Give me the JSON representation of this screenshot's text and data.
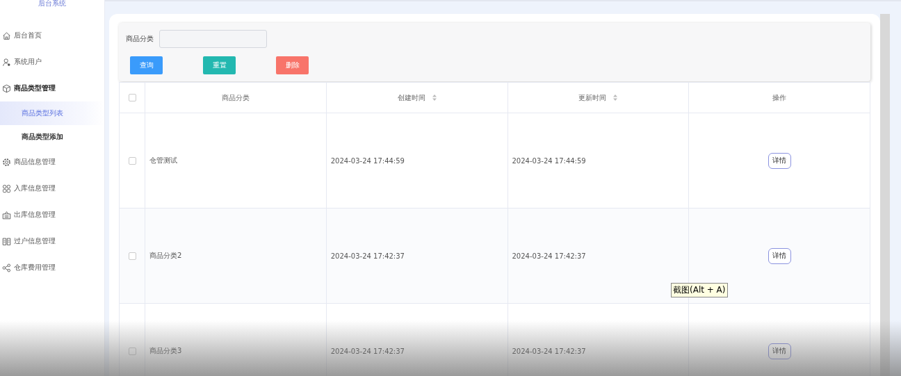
{
  "sidebar": {
    "title": "后台系统",
    "items": [
      {
        "label": "后台首页",
        "selected": false
      },
      {
        "label": "系统用户",
        "selected": false
      },
      {
        "label": "商品类型管理",
        "selected": false,
        "expanded": true,
        "children": [
          {
            "label": "商品类型列表",
            "selected": true
          },
          {
            "label": "商品类型添加",
            "selected": false
          }
        ]
      },
      {
        "label": "商品信息管理",
        "selected": false
      },
      {
        "label": "入库信息管理",
        "selected": false
      },
      {
        "label": "出库信息管理",
        "selected": false
      },
      {
        "label": "过户信息管理",
        "selected": false
      },
      {
        "label": "仓库费用管理",
        "selected": false
      }
    ]
  },
  "search": {
    "label": "商品分类",
    "buttons": [
      {
        "label": "查询",
        "kind": "primary"
      },
      {
        "label": "重置",
        "kind": "reset"
      },
      {
        "label": "删除",
        "kind": "danger"
      }
    ]
  },
  "table": {
    "all_checked": false,
    "columns": [
      {
        "label": "商品分类",
        "sortable": false
      },
      {
        "label": "创建时间",
        "sortable": true
      },
      {
        "label": "更新时间",
        "sortable": true
      },
      {
        "label": "操作",
        "sortable": false
      }
    ],
    "rows": [
      {
        "checked": false,
        "name": "仓管测试",
        "created": "2024-03-24 17:44:59",
        "updated": "2024-03-24 17:44:59",
        "action": "详情"
      },
      {
        "checked": false,
        "name": "商品分类2",
        "created": "2024-03-24 17:42:37",
        "updated": "2024-03-24 17:42:37",
        "action": "详情"
      },
      {
        "checked": false,
        "name": "商品分类3",
        "created": "2024-03-24 17:42:37",
        "updated": "2024-03-24 17:42:37",
        "action": "详情"
      }
    ]
  },
  "tooltip": "截图(Alt + A)"
}
